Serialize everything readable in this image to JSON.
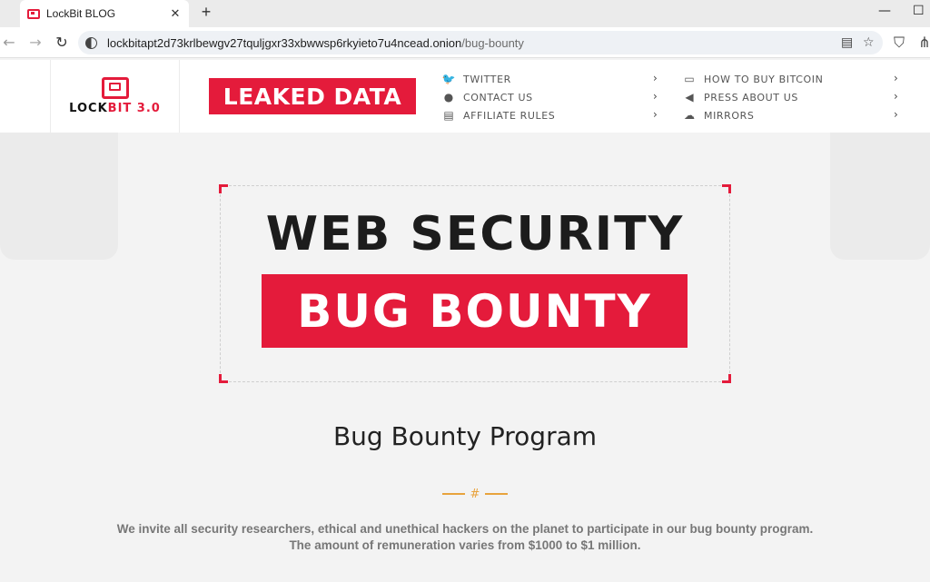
{
  "browser": {
    "tab_title": "LockBit BLOG",
    "tab_close": "✕",
    "new_tab": "+",
    "url_host": "lockbitapt2d73krlbewgv27tquljgxr33xbwwsp6rkyieto7u4ncead.onion",
    "url_path": "/bug-bounty",
    "minimize": "—",
    "maximize": "☐",
    "back": "←",
    "forward": "→",
    "reload": "↻",
    "reader": "▤",
    "star": "☆",
    "shield": "⛉",
    "extensions": "⋔"
  },
  "header": {
    "logo_lock": "LOCK",
    "logo_bit": "BIT 3.0",
    "leaked_button": "LEAKED DATA",
    "menu_left": [
      {
        "label": "TWITTER",
        "icon": "twitter-icon",
        "glyph": "🐦"
      },
      {
        "label": "CONTACT US",
        "icon": "chat-icon",
        "glyph": "●"
      },
      {
        "label": "AFFILIATE RULES",
        "icon": "document-icon",
        "glyph": "▤"
      }
    ],
    "menu_right": [
      {
        "label": "HOW TO BUY BITCOIN",
        "icon": "wallet-icon",
        "glyph": "▭"
      },
      {
        "label": "PRESS ABOUT US",
        "icon": "megaphone-icon",
        "glyph": "◀"
      },
      {
        "label": "MIRRORS",
        "icon": "cloud-icon",
        "glyph": "☁"
      }
    ],
    "chevron": "›"
  },
  "hero": {
    "line1": "WEB SECURITY",
    "line2": "BUG BOUNTY"
  },
  "section": {
    "title": "Bug Bounty Program",
    "divider_glyph": "#",
    "desc_line1": "We invite all security researchers, ethical and unethical hackers on the planet to participate in our bug bounty program.",
    "desc_line2": "The amount of remuneration varies from $1000 to $1 million."
  },
  "colors": {
    "accent": "#e41b3b",
    "divider": "#e8a33d"
  }
}
